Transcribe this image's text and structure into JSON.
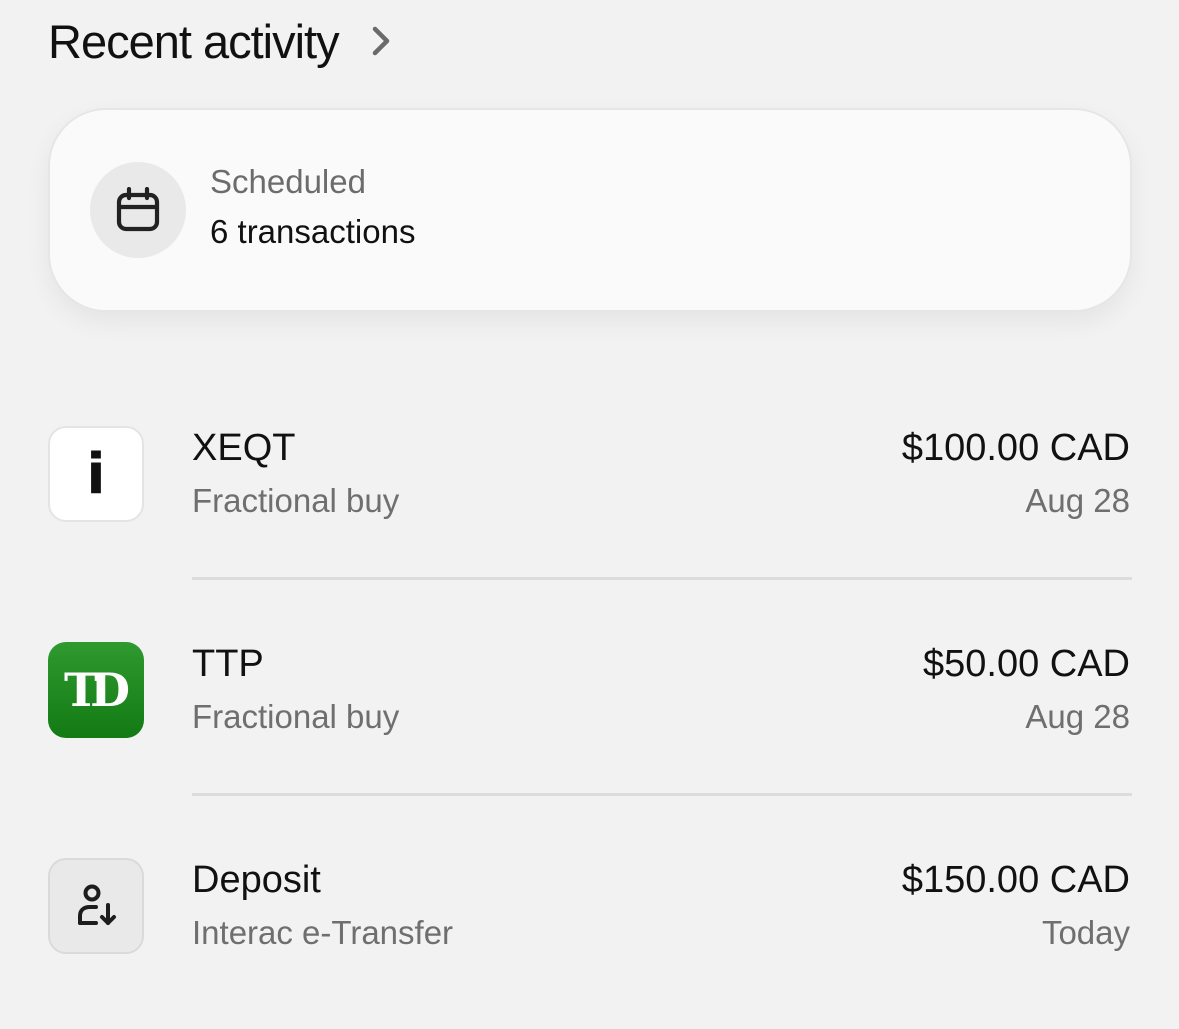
{
  "header": {
    "title": "Recent activity"
  },
  "scheduled": {
    "label": "Scheduled",
    "count": "6 transactions",
    "icon": "calendar-icon"
  },
  "transactions": [
    {
      "title": "XEQT",
      "subtitle": "Fractional buy",
      "amount": "$100.00 CAD",
      "date": "Aug 28",
      "logo": "ishares-logo",
      "logo_text": "i"
    },
    {
      "title": "TTP",
      "subtitle": "Fractional buy",
      "amount": "$50.00 CAD",
      "date": "Aug 28",
      "logo": "td-logo",
      "logo_text": "TD",
      "logo_color": "#1a7f1b"
    },
    {
      "title": "Deposit",
      "subtitle": "Interac e-Transfer",
      "amount": "$150.00 CAD",
      "date": "Today",
      "logo": "person-deposit-icon"
    }
  ]
}
